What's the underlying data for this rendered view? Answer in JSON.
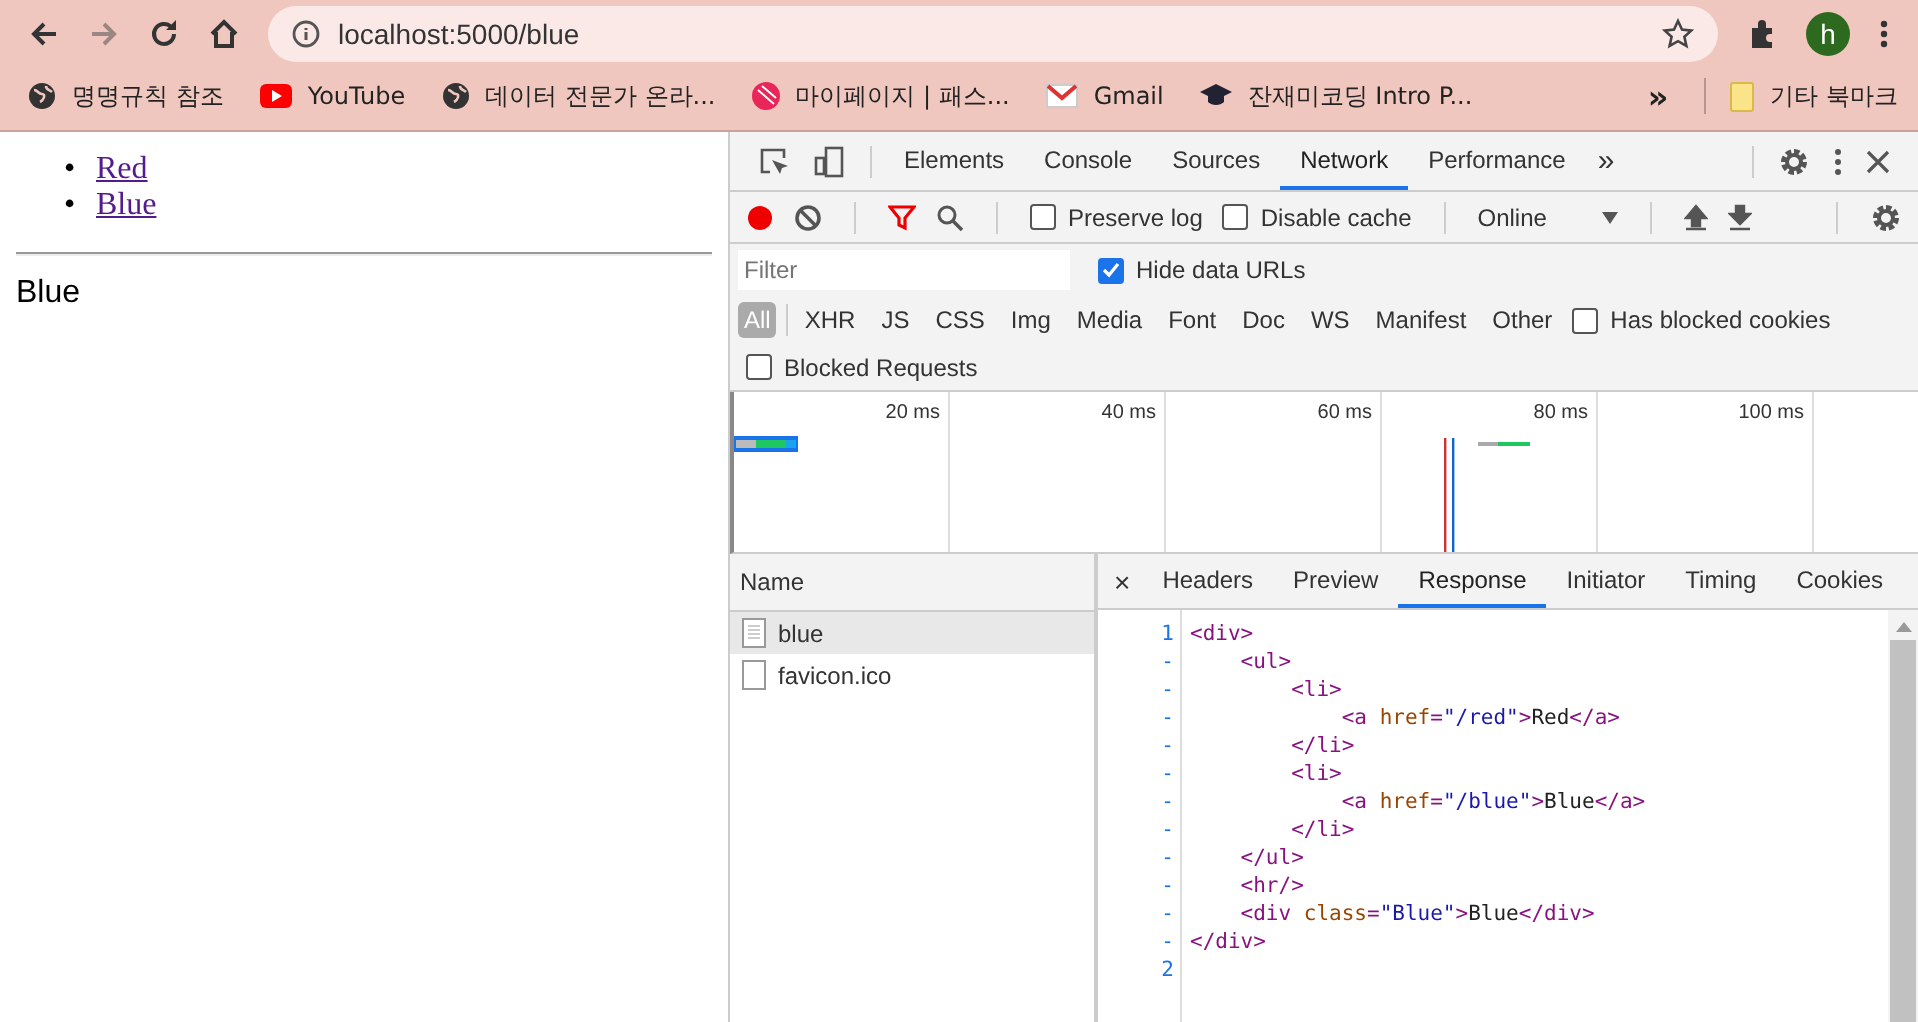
{
  "browser": {
    "forward_disabled": true,
    "url": "localhost:5000/blue",
    "avatar": "h",
    "bookmarks": [
      {
        "kind": "globe",
        "label": "명명규칙 참조"
      },
      {
        "kind": "video",
        "label": "YouTube"
      },
      {
        "kind": "globe",
        "label": "데이터 전문가 온라..."
      },
      {
        "kind": "circle",
        "label": "마이페이지 | 패스..."
      },
      {
        "kind": "mail",
        "label": "Gmail"
      },
      {
        "kind": "cap",
        "label": "잔재미코딩 Intro P..."
      }
    ],
    "more": "»",
    "other_bookmarks": "기타 북마크"
  },
  "page": {
    "links": [
      {
        "marker": "•",
        "label": "Red"
      },
      {
        "marker": "•",
        "label": "Blue"
      }
    ],
    "text": "Blue"
  },
  "devtools": {
    "tabs": [
      {
        "label": "Elements",
        "selected": false
      },
      {
        "label": "Console",
        "selected": false
      },
      {
        "label": "Sources",
        "selected": false
      },
      {
        "label": "Network",
        "selected": true
      },
      {
        "label": "Performance",
        "selected": false
      }
    ],
    "more_tabs": "»",
    "recording": true,
    "filter_active": true,
    "preserve_log": {
      "label": "Preserve log",
      "checked": false
    },
    "disable_cache": {
      "label": "Disable cache",
      "checked": false
    },
    "throttle": "Online",
    "filter": {
      "placeholder": "Filter"
    },
    "hide_data_urls": {
      "label": "Hide data URLs",
      "checked": true
    },
    "types": [
      {
        "label": "All",
        "selected": true
      },
      {
        "label": "XHR",
        "selected": false
      },
      {
        "label": "JS",
        "selected": false
      },
      {
        "label": "CSS",
        "selected": false
      },
      {
        "label": "Img",
        "selected": false
      },
      {
        "label": "Media",
        "selected": false
      },
      {
        "label": "Font",
        "selected": false
      },
      {
        "label": "Doc",
        "selected": false
      },
      {
        "label": "WS",
        "selected": false
      },
      {
        "label": "Manifest",
        "selected": false
      },
      {
        "label": "Other",
        "selected": false
      }
    ],
    "has_blocked_cookies": {
      "label": "Has blocked cookies",
      "checked": false
    },
    "blocked_requests": {
      "label": "Blocked Requests",
      "checked": false
    },
    "overview_ticks": [
      "20 ms",
      "40 ms",
      "60 ms",
      "80 ms",
      "100 ms"
    ],
    "requests": {
      "header": "Name",
      "rows": [
        {
          "name": "blue",
          "kind": "document",
          "selected": true
        },
        {
          "name": "favicon.ico",
          "kind": "blank",
          "selected": false
        }
      ]
    },
    "detail_close": "×",
    "detail_tabs": [
      {
        "label": "Headers",
        "selected": false
      },
      {
        "label": "Preview",
        "selected": false
      },
      {
        "label": "Response",
        "selected": true
      },
      {
        "label": "Initiator",
        "selected": false
      },
      {
        "label": "Timing",
        "selected": false
      },
      {
        "label": "Cookies",
        "selected": false
      }
    ],
    "response_lines": [
      {
        "gutter": "1",
        "tokens": [
          {
            "kind": "tag",
            "text": "<div>"
          }
        ],
        "children": [
          {
            "gutter": "-",
            "tokens": [
              {
                "kind": "tag",
                "text": "<ul>"
              }
            ],
            "children": [
              {
                "gutter": "-",
                "tokens": [
                  {
                    "kind": "tag",
                    "text": "<li>"
                  }
                ],
                "children": [
                  {
                    "gutter": "-",
                    "tokens": [
                      {
                        "kind": "tag",
                        "text": "<a "
                      },
                      {
                        "kind": "attr",
                        "text": "href"
                      },
                      {
                        "kind": "tag",
                        "text": "="
                      },
                      {
                        "kind": "value",
                        "text": "\"/red\""
                      },
                      {
                        "kind": "tag",
                        "text": ">"
                      },
                      {
                        "kind": "text",
                        "text": "Red"
                      },
                      {
                        "kind": "tag",
                        "text": "</a>"
                      }
                    ]
                  }
                ]
              },
              {
                "gutter": "-",
                "tokens": [
                  {
                    "kind": "tag",
                    "text": "</li>"
                  }
                ]
              },
              {
                "gutter": "-",
                "tokens": [
                  {
                    "kind": "tag",
                    "text": "<li>"
                  }
                ],
                "children": [
                  {
                    "gutter": "-",
                    "tokens": [
                      {
                        "kind": "tag",
                        "text": "<a "
                      },
                      {
                        "kind": "attr",
                        "text": "href"
                      },
                      {
                        "kind": "tag",
                        "text": "="
                      },
                      {
                        "kind": "value",
                        "text": "\"/blue\""
                      },
                      {
                        "kind": "tag",
                        "text": ">"
                      },
                      {
                        "kind": "text",
                        "text": "Blue"
                      },
                      {
                        "kind": "tag",
                        "text": "</a>"
                      }
                    ]
                  }
                ]
              },
              {
                "gutter": "-",
                "tokens": [
                  {
                    "kind": "tag",
                    "text": "</li>"
                  }
                ]
              }
            ]
          },
          {
            "gutter": "-",
            "tokens": [
              {
                "kind": "tag",
                "text": "</ul>"
              }
            ]
          },
          {
            "gutter": "-",
            "tokens": [
              {
                "kind": "tag",
                "text": "<hr/>"
              }
            ]
          },
          {
            "gutter": "-",
            "tokens": [
              {
                "kind": "tag",
                "text": "<div "
              },
              {
                "kind": "attr",
                "text": "class"
              },
              {
                "kind": "tag",
                "text": "="
              },
              {
                "kind": "value",
                "text": "\"Blue\""
              },
              {
                "kind": "tag",
                "text": ">"
              },
              {
                "kind": "text",
                "text": "Blue"
              },
              {
                "kind": "tag",
                "text": "</div>"
              }
            ]
          }
        ]
      },
      {
        "gutter": "-",
        "tokens": [
          {
            "kind": "tag",
            "text": "</div>"
          }
        ]
      },
      {
        "gutter": "2"
      }
    ]
  }
}
